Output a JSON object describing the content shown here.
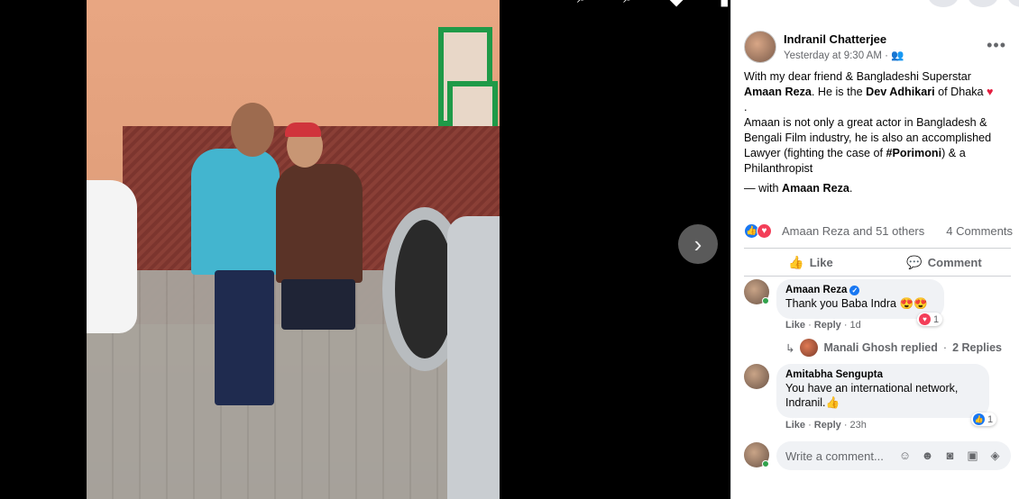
{
  "post": {
    "author": "Indranil Chatterjee",
    "time": "Yesterday at 9:30 AM",
    "privacy_sep": " · ",
    "text": {
      "l1": "With my dear friend & Bangladeshi Superstar",
      "name1": "Amaan Reza",
      "l2": ". He is the ",
      "name2": "Dev Adhikari",
      "l3": " of Dhaka ",
      "l4": ".",
      "l5": "Amaan is not only a great actor in Bangladesh & Bengali Film industry, he is also an accomplished Lawyer (fighting the case of ",
      "hashtag": "#Porimoni",
      "l6": ") & a Philanthropist",
      "with_prefix": "— with ",
      "with_name": "Amaan Reza",
      "with_suffix": "."
    },
    "reactions_text": "Amaan Reza and 51 others",
    "comments_count": "4 Comments",
    "like_label": "Like",
    "comment_label": "Comment"
  },
  "comments": [
    {
      "name": "Amaan Reza",
      "text": "Thank you Baba Indra 😍😍",
      "like": "Like",
      "reply": "Reply",
      "age": "1d",
      "reaction_count": "1"
    },
    {
      "name": "Amitabha Sengupta",
      "text": "You have an international network, Indranil.👍",
      "like": "Like",
      "reply": "Reply",
      "age": "23h",
      "reaction_count": "1"
    }
  ],
  "reply_summary": {
    "name": "Manali Ghosh replied",
    "sep": " · ",
    "count": "2 Replies"
  },
  "composer": {
    "placeholder": "Write a comment..."
  },
  "colors": {
    "like_blue": "#1877f2",
    "love_red": "#f33e58",
    "online_green": "#31a24c"
  }
}
